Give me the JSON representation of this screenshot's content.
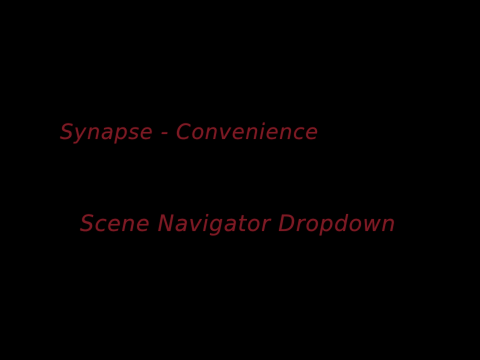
{
  "slide": {
    "title": "Synapse - Convenience",
    "subtitle": "Scene Navigator Dropdown",
    "background_color": "#000000",
    "text_color": "#7d1a24"
  }
}
